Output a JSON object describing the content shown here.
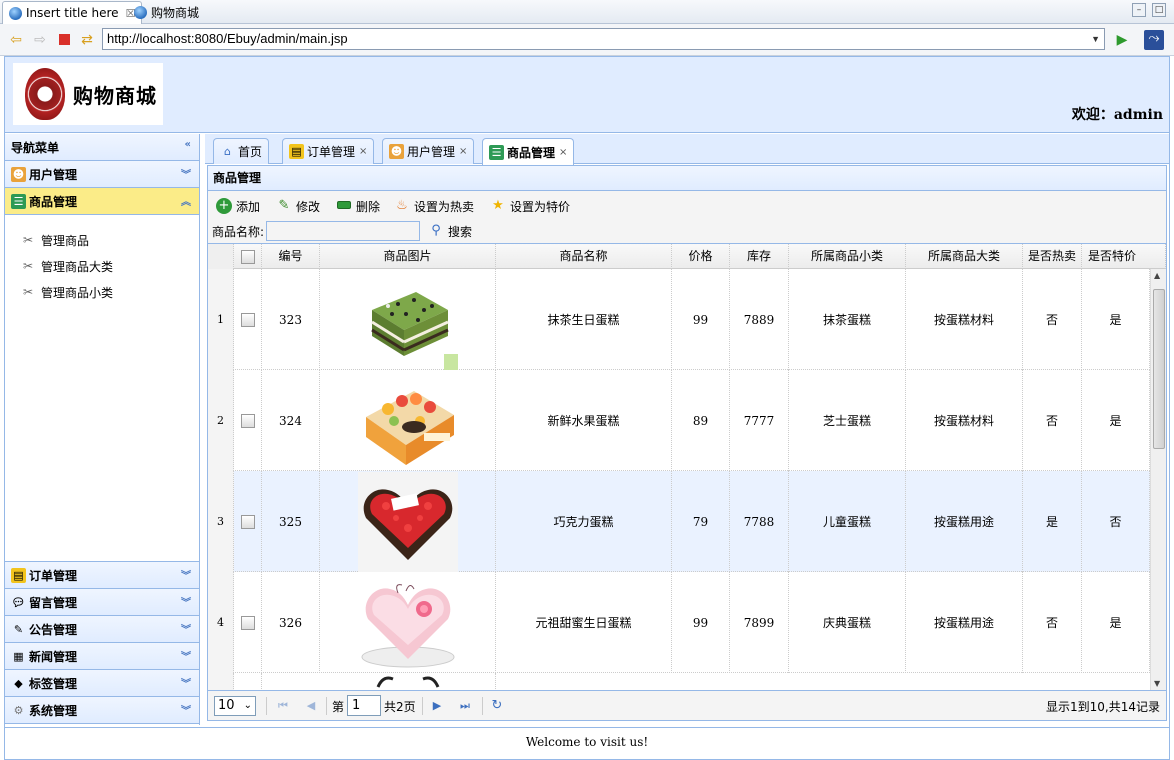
{
  "ide": {
    "tabs": [
      {
        "label": "Insert title here",
        "close": "☒"
      },
      {
        "label": "购物商城"
      }
    ],
    "url": "http://localhost:8080/Ebuy/admin/main.jsp"
  },
  "header": {
    "logo_text": "购物商城",
    "welcome": "欢迎：admin"
  },
  "sidebar": {
    "title": "导航菜单",
    "groups": [
      {
        "label": "用户管理",
        "icon": "users-icon"
      },
      {
        "label": "商品管理",
        "icon": "list-icon",
        "items": [
          "管理商品",
          "管理商品大类",
          "管理商品小类"
        ]
      },
      {
        "label": "订单管理",
        "icon": "order-icon"
      },
      {
        "label": "留言管理",
        "icon": "comment-icon"
      },
      {
        "label": "公告管理",
        "icon": "notice-icon"
      },
      {
        "label": "新闻管理",
        "icon": "news-icon"
      },
      {
        "label": "标签管理",
        "icon": "tag-icon"
      },
      {
        "label": "系统管理",
        "icon": "gear-icon"
      }
    ]
  },
  "tabs": [
    {
      "label": "首页"
    },
    {
      "label": "订单管理"
    },
    {
      "label": "用户管理"
    },
    {
      "label": "商品管理"
    }
  ],
  "panel": {
    "title": "商品管理",
    "toolbar": {
      "add": "添加",
      "edit": "修改",
      "delete": "删除",
      "hot": "设置为热卖",
      "special": "设置为特价"
    },
    "search_label": "商品名称:",
    "search_button": "搜索"
  },
  "grid": {
    "columns": [
      "编号",
      "商品图片",
      "商品名称",
      "价格",
      "库存",
      "所属商品小类",
      "所属商品大类",
      "是否热卖",
      "是否特价"
    ],
    "rows": [
      {
        "n": "1",
        "id": "323",
        "name": "抹茶生日蛋糕",
        "price": "99",
        "stock": "7889",
        "sub": "抹茶蛋糕",
        "cat": "按蛋糕材料",
        "hot": "否",
        "special": "是"
      },
      {
        "n": "2",
        "id": "324",
        "name": "新鲜水果蛋糕",
        "price": "89",
        "stock": "7777",
        "sub": "芝士蛋糕",
        "cat": "按蛋糕材料",
        "hot": "否",
        "special": "是"
      },
      {
        "n": "3",
        "id": "325",
        "name": "巧克力蛋糕",
        "price": "79",
        "stock": "7788",
        "sub": "儿童蛋糕",
        "cat": "按蛋糕用途",
        "hot": "是",
        "special": "否"
      },
      {
        "n": "4",
        "id": "326",
        "name": "元祖甜蜜生日蛋糕",
        "price": "99",
        "stock": "7899",
        "sub": "庆典蛋糕",
        "cat": "按蛋糕用途",
        "hot": "否",
        "special": "是"
      }
    ]
  },
  "pager": {
    "page_size": "10",
    "page_prefix": "第",
    "page_value": "1",
    "page_suffix": "共2页",
    "info": "显示1到10,共14记录"
  },
  "footer": "Welcome to visit us!"
}
